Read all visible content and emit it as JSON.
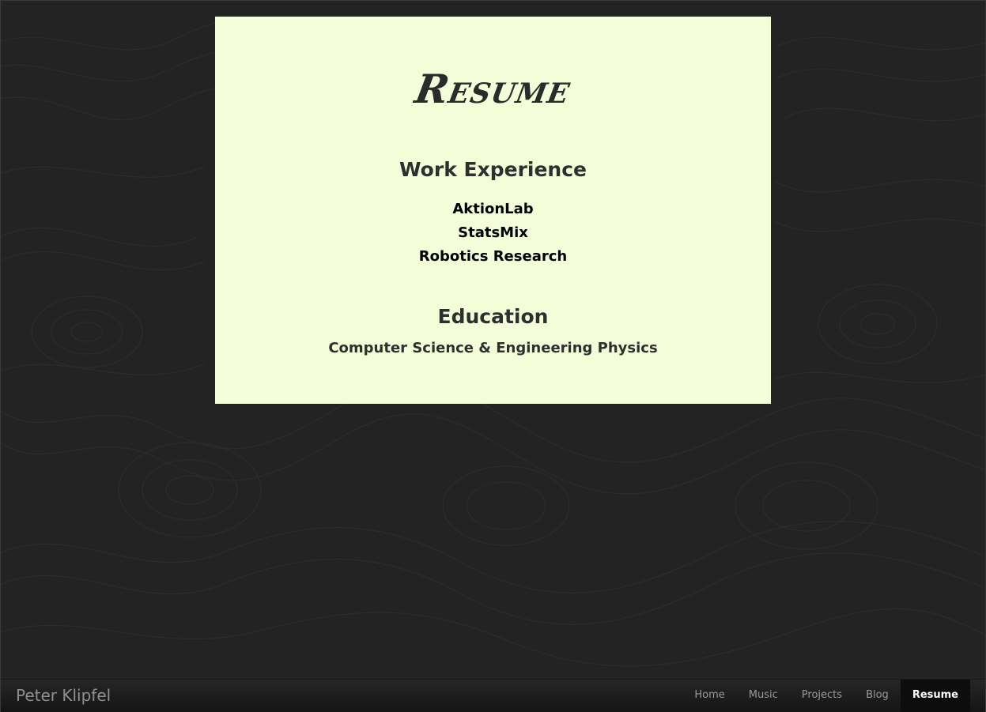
{
  "page": {
    "title": "Resume"
  },
  "sections": {
    "work": {
      "heading": "Work Experience",
      "items": [
        "AktionLab",
        "StatsMix",
        "Robotics Research"
      ]
    },
    "education": {
      "heading": "Education",
      "items": [
        "Computer Science & Engineering Physics"
      ]
    }
  },
  "footer": {
    "brand": "Peter Klipfel",
    "nav": [
      {
        "label": "Home",
        "active": false
      },
      {
        "label": "Music",
        "active": false
      },
      {
        "label": "Projects",
        "active": false
      },
      {
        "label": "Blog",
        "active": false
      },
      {
        "label": "Resume",
        "active": true
      }
    ]
  },
  "colors": {
    "background": "#232323",
    "card": "#f3fed8",
    "nav_active_bg": "#0d0d0d"
  }
}
